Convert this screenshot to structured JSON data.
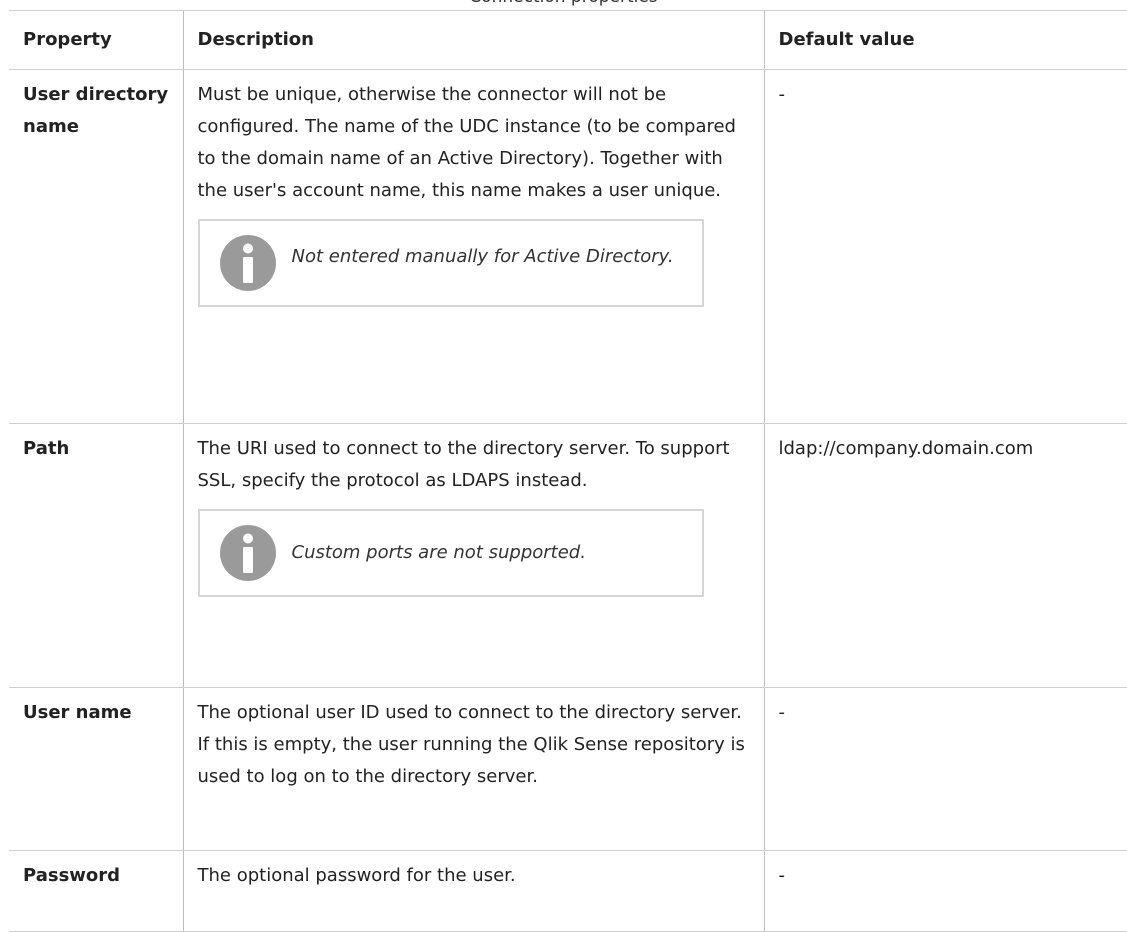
{
  "caption": "Connection properties",
  "table": {
    "headers": [
      "Property",
      "Description",
      "Default value"
    ],
    "rows": [
      {
        "property": "User directory name",
        "description": "Must be unique, otherwise the connector will not be configured. The name of the UDC instance (to be compared to the domain name of an Active Directory). Together with the user's account name, this name makes a user unique.",
        "note": "Not entered manually for Active Directory.",
        "default": "-"
      },
      {
        "property": "Path",
        "description": "The URI used to connect to the directory server. To support SSL, specify the protocol as LDAPS instead.",
        "note": "Custom ports are not supported.",
        "default": "ldap://company.domain.com"
      },
      {
        "property": "User name",
        "description": "The optional user ID used to connect to the directory server. If this is empty, the user running the Qlik Sense repository is used to log on to the directory server.",
        "default": "-"
      },
      {
        "property": "Password",
        "description": "The optional password for the user.",
        "default": "-"
      }
    ]
  },
  "colors": {
    "border": "#cfcfcf",
    "note_border": "#d6d6d6",
    "icon_fill": "#9a9a9a",
    "text": "#222222"
  },
  "icons": {
    "note_icon": "info-icon"
  }
}
